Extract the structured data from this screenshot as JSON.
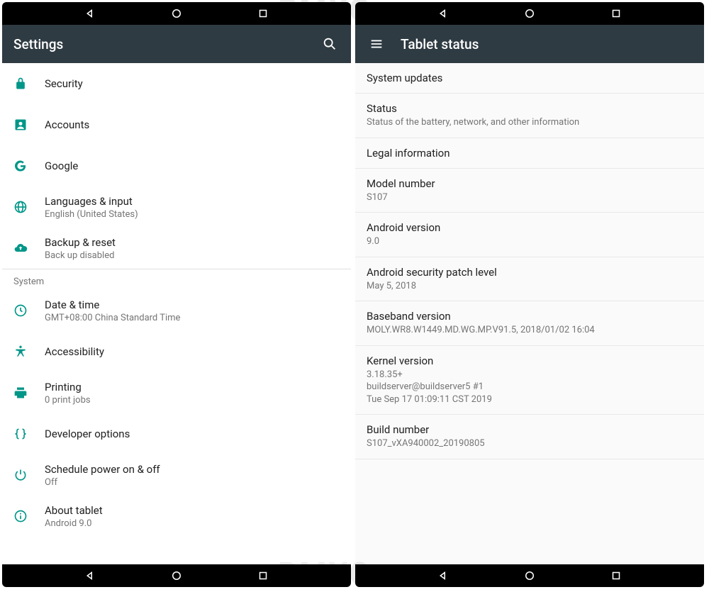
{
  "watermark": "BMXC",
  "left": {
    "appbar_title": "Settings",
    "items": [
      {
        "icon": "lock",
        "primary": "Security"
      },
      {
        "icon": "account",
        "primary": "Accounts"
      },
      {
        "icon": "google",
        "primary": "Google"
      },
      {
        "icon": "globe",
        "primary": "Languages & input",
        "secondary": "English (United States)"
      },
      {
        "icon": "cloud-up",
        "primary": "Backup & reset",
        "secondary": "Back up disabled"
      }
    ],
    "section_header": "System",
    "system_items": [
      {
        "icon": "clock",
        "primary": "Date & time",
        "secondary": "GMT+08:00 China Standard Time"
      },
      {
        "icon": "accessibility",
        "primary": "Accessibility"
      },
      {
        "icon": "print",
        "primary": "Printing",
        "secondary": "0 print jobs"
      },
      {
        "icon": "braces",
        "primary": "Developer options"
      },
      {
        "icon": "power",
        "primary": "Schedule power on & off",
        "secondary": "Off"
      },
      {
        "icon": "info",
        "primary": "About tablet",
        "secondary": "Android 9.0"
      }
    ]
  },
  "right": {
    "appbar_title": "Tablet status",
    "rows": [
      {
        "primary": "System updates"
      },
      {
        "primary": "Status",
        "secondary": "Status of the battery, network, and other information"
      },
      {
        "primary": "Legal information"
      },
      {
        "primary": "Model number",
        "secondary": "S107"
      },
      {
        "primary": "Android version",
        "secondary": "9.0"
      },
      {
        "primary": "Android security patch level",
        "secondary": "May 5, 2018"
      },
      {
        "primary": "Baseband version",
        "secondary": "MOLY.WR8.W1449.MD.WG.MP.V91.5, 2018/01/02 16:04"
      },
      {
        "primary": "Kernel version",
        "secondary": "3.18.35+\nbuildserver@buildserver5 #1\nTue Sep 17 01:09:11 CST 2019"
      },
      {
        "primary": "Build number",
        "secondary": "S107_vXA940002_20190805"
      }
    ]
  }
}
